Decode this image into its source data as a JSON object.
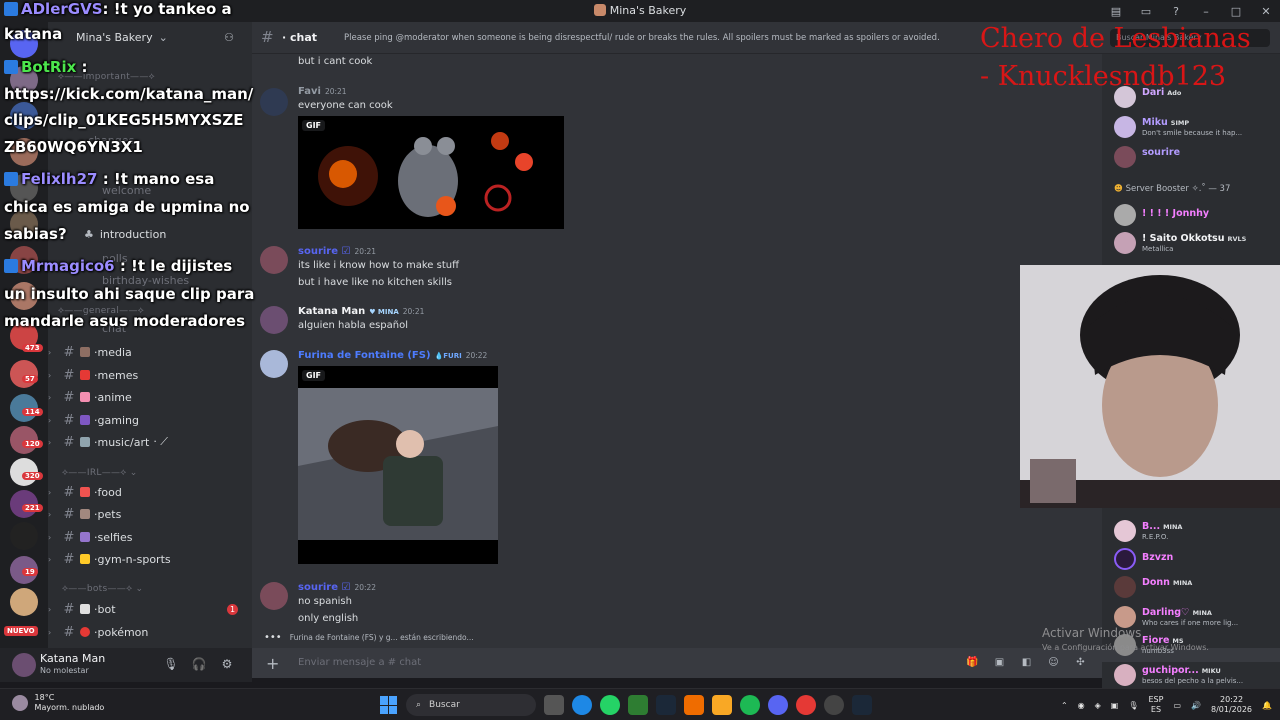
{
  "window": {
    "title": "Mina's Bakery"
  },
  "server": {
    "name": "Mina's Bakery"
  },
  "sidebar": {
    "categories": {
      "important": "important",
      "general": "general",
      "irl": "IRL",
      "bots": "bots"
    },
    "faded_channels": [
      "changes",
      "welcome",
      "polls",
      "birthday-wishes",
      "chat"
    ],
    "introduction": "introduction",
    "channels": [
      {
        "name": "media",
        "color": "#8d6e63"
      },
      {
        "name": "memes",
        "color": "#e53935"
      },
      {
        "name": "anime",
        "color": "#f48fb1"
      },
      {
        "name": "gaming",
        "color": "#7e57c2"
      },
      {
        "name": "music/art",
        "color": "#90a4ae"
      },
      {
        "name": "food",
        "color": "#ef5350"
      },
      {
        "name": "pets",
        "color": "#a1887f"
      },
      {
        "name": "selfies",
        "color": "#9575cd"
      },
      {
        "name": "gym-n-sports",
        "color": "#ffca28"
      },
      {
        "name": "bot",
        "color": "#e0e0e0",
        "unread": "1"
      },
      {
        "name": "pokémon",
        "color": "#e53935"
      }
    ]
  },
  "rail": {
    "badges": [
      "473",
      "57",
      "114",
      "120",
      "320",
      "221",
      "19"
    ],
    "nuevo": "NUEVO"
  },
  "user": {
    "name": "Katana Man",
    "status": "No molestar"
  },
  "chat": {
    "channel": "chat",
    "topic": "Please ping @moderator when someone is being disrespectful/ rude or breaks the rules. All spoilers must be marked as spoilers or avoided.",
    "search": "Buscar Mina's Bakery",
    "messages": [
      {
        "text": "but i cant cook"
      },
      {
        "author": "Favi",
        "time": "20:21",
        "text": "everyone can cook",
        "gif": "GIF",
        "color": "#949ba4"
      },
      {
        "author": "sourire",
        "time": "20:21",
        "lines": [
          "its like i know how to make stuff",
          "but i have like no kitchen skills"
        ],
        "color": "#5865f2"
      },
      {
        "author": "Katana Man",
        "tag": "MINA",
        "time": "20:21",
        "text": "alguien habla español",
        "color": "#f2f3f5"
      },
      {
        "author": "Furina de Fontaine (FS)",
        "tag": "FURI",
        "time": "20:22",
        "gif": "GIF",
        "color": "#4d7cff"
      },
      {
        "author": "sourire",
        "time": "20:22",
        "lines": [
          "no spanish",
          "only english"
        ],
        "color": "#5865f2"
      }
    ],
    "typing": "Furina de Fontaine (FS) y g... están escribiendo...",
    "placeholder": "Enviar mensaje a # chat"
  },
  "members": {
    "top": [
      {
        "name": "Dari",
        "tag": "Ado",
        "color": "#d0a6ff"
      },
      {
        "name": "Miku",
        "tag": "SIMP",
        "status": "Don't smile because it hap...",
        "color": "#b39cff"
      },
      {
        "name": "sourire",
        "color": "#b39cff"
      }
    ],
    "booster_group": "Server Booster ✧.˚ — 37",
    "boosters": [
      {
        "name": "! ! ! ! Jonnhy",
        "color": "#f47fff"
      },
      {
        "name": "! Saito Okkotsu",
        "tag": "RVLS",
        "status": "Metallica",
        "color": "#f2f3f5"
      }
    ],
    "lower": [
      {
        "name": "B...",
        "tag": "MINA",
        "status": "R.E.P.O.",
        "color": "#f47fff"
      },
      {
        "name": "Bzvzn",
        "color": "#f47fff"
      },
      {
        "name": "Donn",
        "tag": "MINA",
        "color": "#f47fff"
      },
      {
        "name": "Darling♡",
        "tag": "MINA",
        "status": "Who cares if one more lig...",
        "color": "#f47fff"
      },
      {
        "name": "Fiore",
        "tag": "MS",
        "status": "numb3ss",
        "color": "#f47fff"
      },
      {
        "name": "guchipor...",
        "tag": "MIKU",
        "status": "besos del pecho a la pelvis...",
        "color": "#f47fff"
      }
    ]
  },
  "stream_chat": [
    {
      "user": "ADlerGVS",
      "text": ": !t yo tankeo a"
    },
    {
      "text": "katana"
    },
    {
      "user": "BotRix",
      "text": " :",
      "green": true
    },
    {
      "text": "https://kick.com/katana_man/"
    },
    {
      "text": "clips/clip_01KEG5H5MYXSZE"
    },
    {
      "text": "ZB60WQ6YN3X1"
    },
    {
      "user": "Felixlh27",
      "text": " : !t mano esa"
    },
    {
      "text": "chica es amiga de upmina no"
    },
    {
      "text": "sabias?"
    },
    {
      "user": "Mrmagico6",
      "text": " : !t le dijistes"
    },
    {
      "text": "un insulto ahi saque clip para"
    },
    {
      "text": "mandarle asus moderadores"
    }
  ],
  "overlay_red": [
    "Chero de Lesbianas",
    "- Knucklesndb123"
  ],
  "activate": {
    "title": "Activar Windows",
    "sub": "Ve a Configuración para activar Windows."
  },
  "taskbar": {
    "weather_temp": "18°C",
    "weather_desc": "Mayorm. nublado",
    "search": "Buscar",
    "lang": "ESP",
    "lang2": "ES",
    "time": "20:22",
    "date": "8/01/2026"
  },
  "colors": {
    "accent": "#5865f2",
    "danger": "#da373c",
    "bg": "#313338"
  }
}
